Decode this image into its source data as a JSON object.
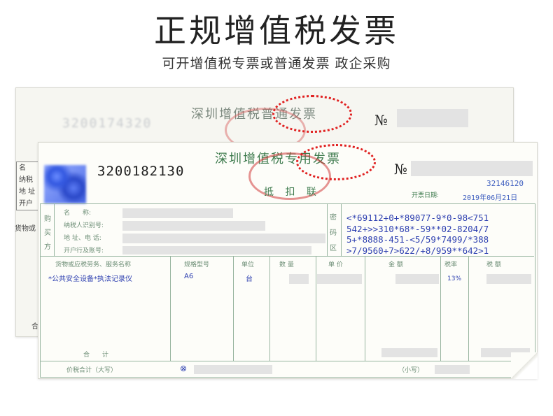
{
  "header": {
    "title": "正规增值税发票",
    "subtitle": "可开增值税专票或普通发票  政企采购"
  },
  "back_invoice": {
    "title": "深圳增值税普通发票",
    "number_label": "№",
    "code": "3200174320",
    "left_labels": [
      "名",
      "纳税",
      "地 址",
      "开户"
    ],
    "goods_label": "货物或",
    "footer_label": "合"
  },
  "front_invoice": {
    "title": "深圳增值税专用发票",
    "number_label": "№",
    "code": "3200182130",
    "copy_label": "抵 扣 联",
    "invoice_no": "32146120",
    "date_label": "开票日期:",
    "date_value": "2019年06月21日",
    "buyer_side_label": [
      "购",
      "买",
      "方"
    ],
    "buyer_fields": [
      "名　　称:",
      "纳税人识别号:",
      "地 址、电 话:",
      "开户行及账号:"
    ],
    "cipher_side_label": [
      "密",
      "码",
      "区"
    ],
    "cipher_lines": [
      "<*69112+0+*89077-9*0-98<751",
      "542+>>310*68*-59**02-8204/7",
      "5+*8888-451-<5/59*7499/*388",
      ">7/9560+7>622/+8/959**642>1"
    ],
    "columns": [
      "货物或应税劳务、服务名称",
      "规格型号",
      "单位",
      "数  量",
      "单  价",
      "金  额",
      "税率",
      "税  额"
    ],
    "row": {
      "name": "*公共安全设备*执法记录仪",
      "model": "A6",
      "unit": "台",
      "tax_rate": "13%"
    },
    "total_label": "合　　计",
    "grand_total_label": "价税合计（大写）",
    "grand_total_symbol": "⊗",
    "small_caps_label": "（小写）"
  },
  "colors": {
    "invoice_green": "#3d7a4d",
    "print_blue": "#2d3fb0",
    "highlight_red": "#e02020"
  }
}
